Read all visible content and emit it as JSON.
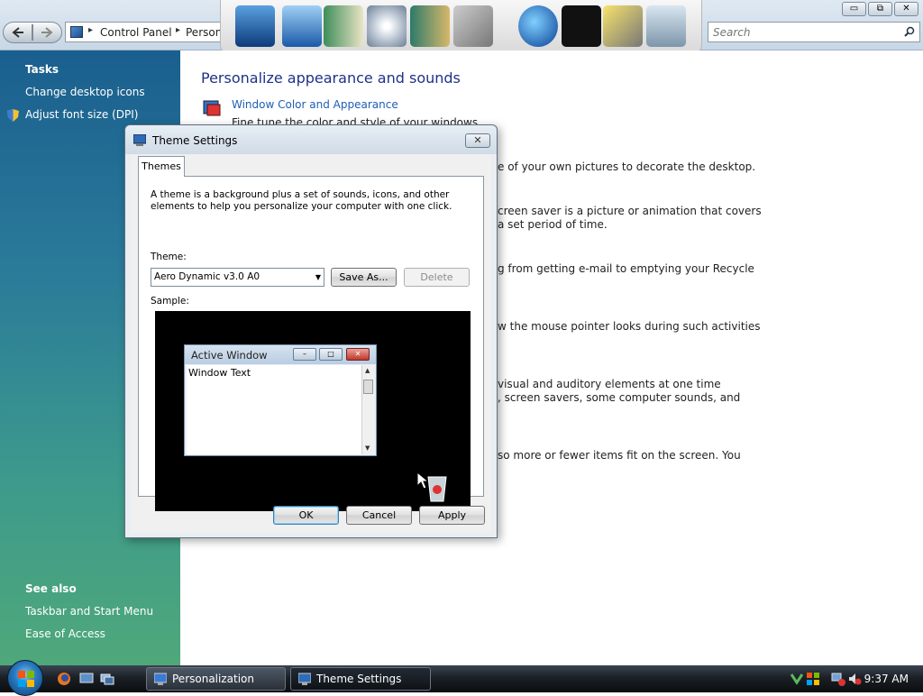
{
  "window": {
    "breadcrumbs": [
      "Control Panel",
      "Personaliz"
    ],
    "search_placeholder": "Search",
    "controls": [
      "minimize",
      "maximize",
      "close"
    ]
  },
  "dock": {
    "icons": [
      "monitor-icon",
      "computer-icon",
      "document-icon",
      "disc-icon",
      "picture-icon",
      "tools-icon",
      "globe-icon",
      "tshirt-icon",
      "wand-icon",
      "recycle-bin-icon"
    ]
  },
  "sidebar": {
    "tasks_title": "Tasks",
    "tasks": [
      {
        "label": "Change desktop icons"
      },
      {
        "label": "Adjust font size (DPI)"
      }
    ],
    "see_also_title": "See also",
    "see_also": [
      {
        "label": "Taskbar and Start Menu"
      },
      {
        "label": "Ease of Access"
      }
    ]
  },
  "main": {
    "title": "Personalize appearance and sounds",
    "items": [
      {
        "link": "Window Color and Appearance",
        "desc": "Fine tune the color and style of your windows."
      },
      {
        "desc": "e of your own pictures to decorate the desktop."
      },
      {
        "desc1": "creen saver is a picture or animation that covers",
        "desc2": "a set period of time."
      },
      {
        "desc": "g from getting e-mail to emptying your Recycle"
      },
      {
        "desc": "w the mouse pointer looks during such activities"
      },
      {
        "desc1": "visual and auditory elements at one time",
        "desc2": ", screen savers, some computer sounds, and"
      },
      {
        "desc": "so more or fewer items fit on the screen. You"
      }
    ]
  },
  "dialog": {
    "title": "Theme Settings",
    "tab": "Themes",
    "intro": "A theme is a background plus a set of sounds, icons, and other elements to help you personalize your computer with one click.",
    "theme_label": "Theme:",
    "theme_value": "Aero Dynamic v3.0 A0",
    "save_as": "Save As...",
    "delete": "Delete",
    "sample_label": "Sample:",
    "sample": {
      "active_window": "Active Window",
      "window_text": "Window Text"
    },
    "ok": "OK",
    "cancel": "Cancel",
    "apply": "Apply"
  },
  "taskbar": {
    "buttons": [
      {
        "label": "Personalization"
      },
      {
        "label": "Theme Settings"
      }
    ],
    "time": "9:37 AM"
  }
}
